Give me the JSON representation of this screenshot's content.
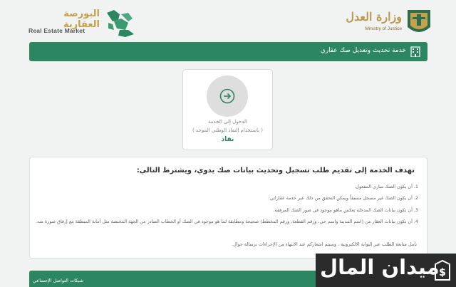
{
  "header": {
    "market_name_ar": "البورصة العقارية",
    "market_name_en": "Real Estate Market",
    "ministry_name_ar": "وزارة العدل",
    "ministry_name_en": "Ministry of Justice"
  },
  "title_bar": {
    "title": "خدمة تحديث وتعديل صك عقاري"
  },
  "login": {
    "line1": "الدخول إلى الخدمة",
    "line2": "( باستخدام النفاذ الوطني الموحد )",
    "nafath": "نفاذ"
  },
  "info": {
    "title": "تهدف الخدمة إلى تقديم طلب تسجيل وتحديث بيانات صك يدوي، ويشترط التالي:",
    "conditions": [
      "1. أن يكون الصك ساري المفعول.",
      "2. أن يكون الصك غير مسجل مسبقاً ويمكن التحقق من ذلك عبر خدمة عقاراتي.",
      "3. أن تكون بيانات الصك المدخلة تعكس ماهو موجود في صور الصك المرفقة.",
      "4. أن تكون بيانات العقار من (اسم المدينة واسم حي، ورقم القطعة، ورقم المخطط) صحيحة ومطابقة لما هو موجود في الصك أو الخطاب الصادر من الجهة المختصة مثل أمانة المنطقة مع إرفاق صورة منه."
    ],
    "note": "نأمل متابعة الطلب عبر البوابة الالكترونية ، وسيتم اشعاركم عند الانتهاء من الإجراءات برسالة جوال."
  },
  "footer": {
    "social": "شبكات التواصل الإجتماعي"
  },
  "watermark": {
    "text": "ميدان المال"
  },
  "colors": {
    "primary_green": "#2d8662",
    "gold": "#c2a24b",
    "background": "#f1f2f2"
  }
}
